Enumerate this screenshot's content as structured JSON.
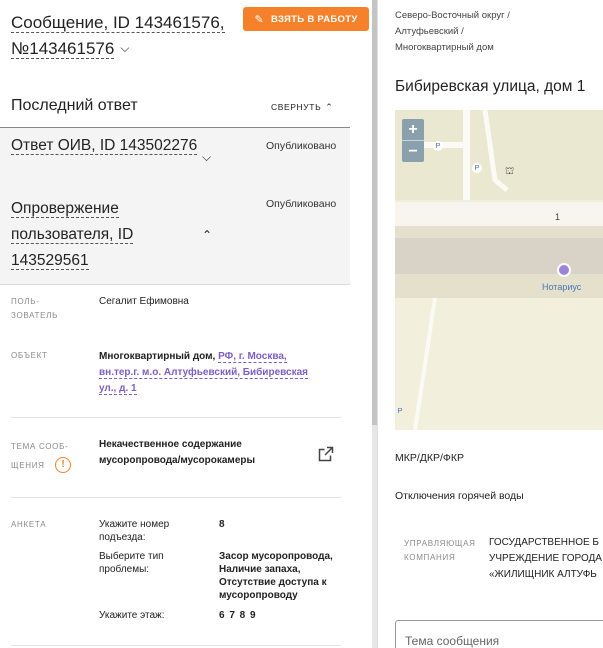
{
  "message": {
    "title": "Сообщение, ID 143461576, №143461576",
    "take_button": "ВЗЯТЬ В РАБОТУ"
  },
  "last_answer": {
    "heading": "Последний ответ",
    "collapse_label": "СВЕРНУТЬ",
    "answers": [
      {
        "title": "Ответ ОИВ, ID 143502276",
        "status": "Опубликовано"
      },
      {
        "title": "Опровержение пользователя, ID 143529561",
        "status": "Опубликовано"
      }
    ]
  },
  "details": {
    "user_label": "ПОЛЬ- ЗОВАТЕЛЬ",
    "user_value": "Сегалит Ефимовна",
    "object_label": "ОБЪЕКТ",
    "object_type": "Многоквартирный дом, ",
    "object_address": "РФ, г. Москва, вн.тер.г. м.о. Алтуфьевский, Бибиревская ул., д. 1",
    "topic_label": "ТЕМА СООБ- ЩЕНИЯ",
    "topic_value": "Некачественное содержание мусоропровода/мусорокамеры",
    "survey_label": "АНКЕТА",
    "survey": [
      {
        "q": "Укажите номер подъезда:",
        "a": "8"
      },
      {
        "q": "Выберите тип проблемы:",
        "a": "Засор мусоропровода, Наличие запаха, Отсутствие доступа к мусоропроводу"
      },
      {
        "q": "Укажите этаж:",
        "a": "6 7 8 9"
      }
    ]
  },
  "right": {
    "breadcrumb": [
      "Северо-Восточный округ /",
      "Алтуфьевский /",
      "Многоквартирный дом"
    ],
    "street": "Бибиревская улица, дом 1",
    "map": {
      "zoom_in": "+",
      "zoom_out": "−",
      "poi_label": "Нотариус",
      "road_number": "1",
      "parking": "P"
    },
    "housing_type": "МКР/ДКР/ФКР",
    "hot_water": "Отключения горячей воды",
    "manager_label": "УПРАВЛЯЮЩАЯ КОМПАНИЯ",
    "manager_value": [
      "ГОСУДАРСТВЕННОЕ Б",
      "УЧРЕЖДЕНИЕ ГОРОДА",
      "«ЖИЛИЩНИК АЛТУФЬ"
    ],
    "message_placeholder": "Тема сообщения"
  }
}
